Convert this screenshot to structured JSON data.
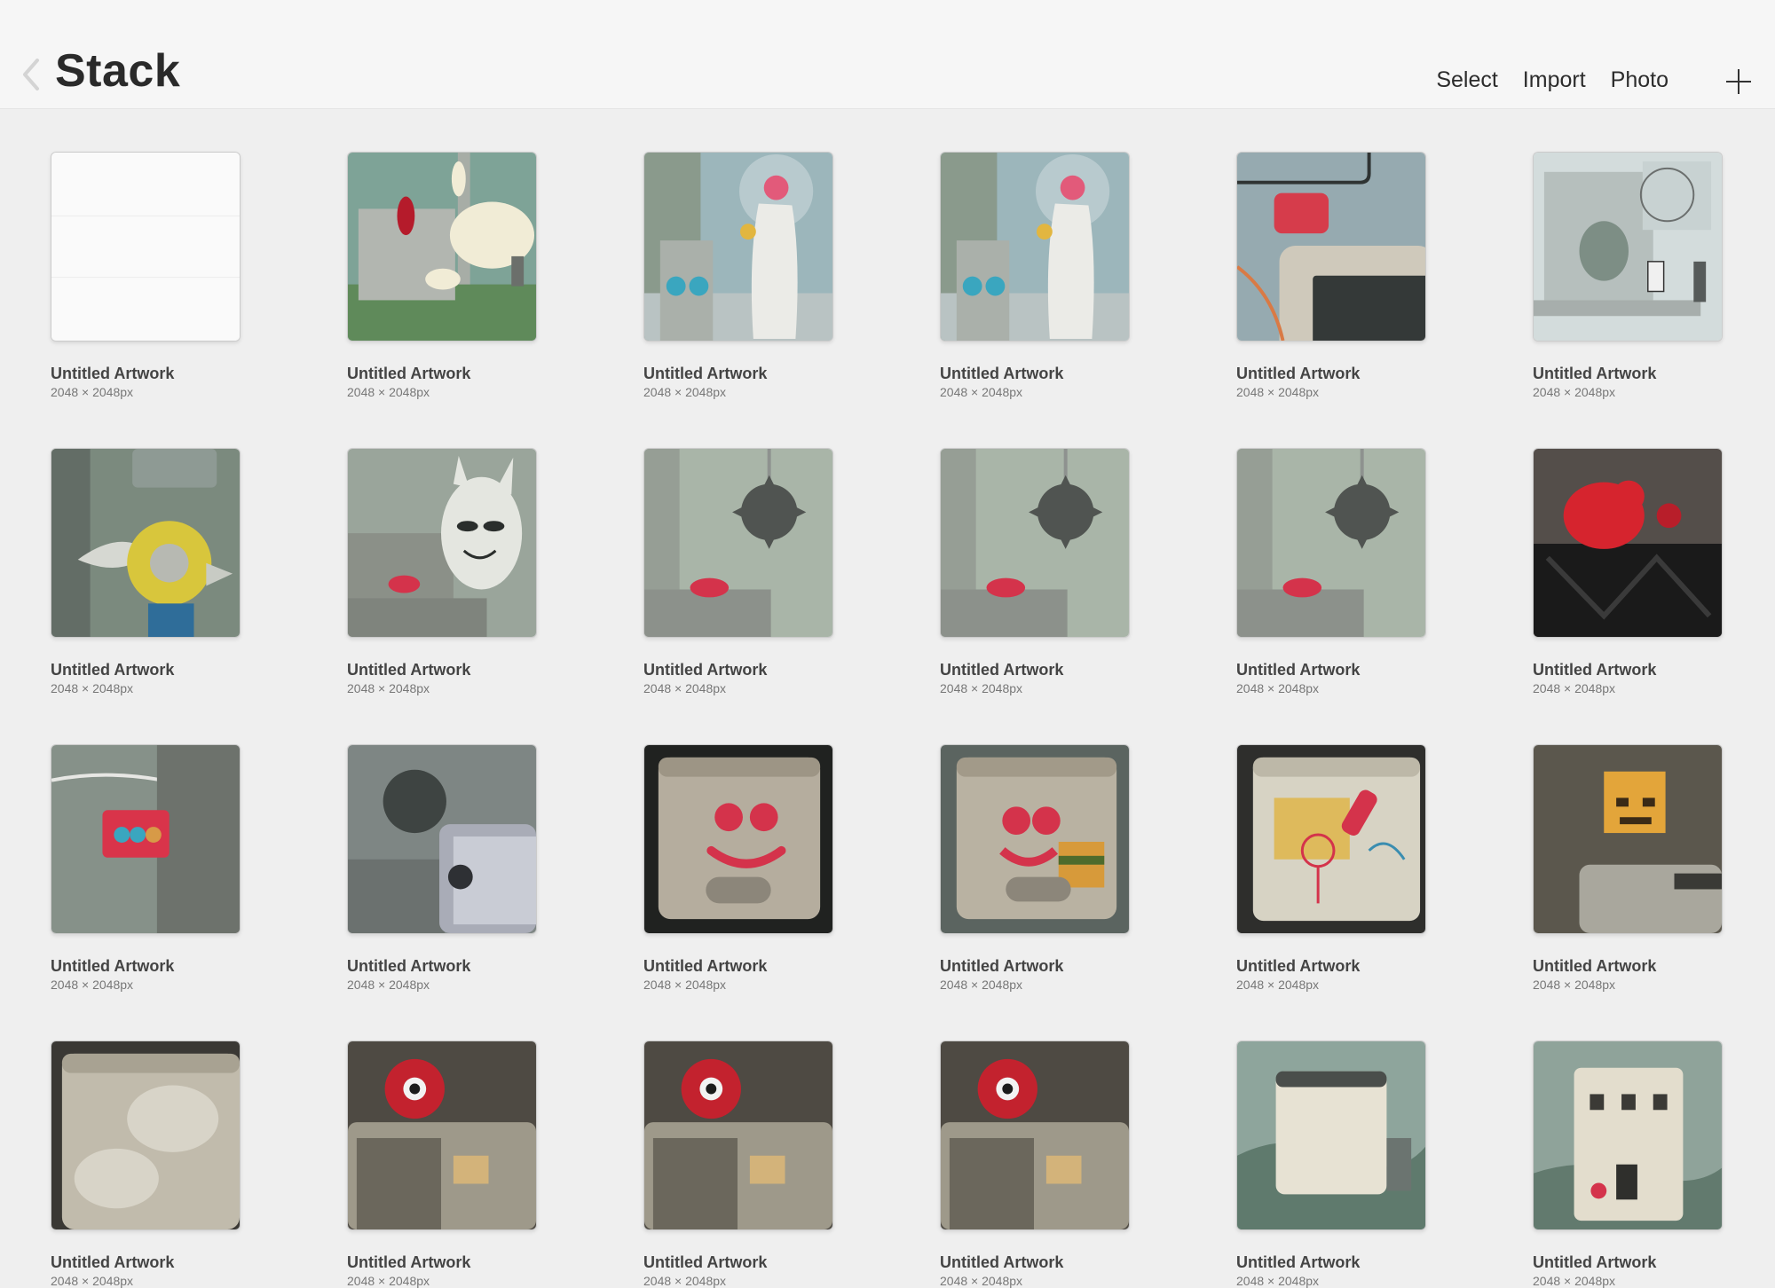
{
  "header": {
    "title": "Stack",
    "actions": [
      {
        "label": "Select"
      },
      {
        "label": "Import"
      },
      {
        "label": "Photo"
      }
    ],
    "back_icon": "chevron-left-icon",
    "add_icon": "plus-icon"
  },
  "artworks": [
    {
      "name": "Untitled Artwork",
      "size": "2048 × 2048px",
      "art": "blank"
    },
    {
      "name": "Untitled Artwork",
      "size": "2048 × 2048px",
      "art": "creature"
    },
    {
      "name": "Untitled Artwork",
      "size": "2048 × 2048px",
      "art": "astronaut"
    },
    {
      "name": "Untitled Artwork",
      "size": "2048 × 2048px",
      "art": "astronaut"
    },
    {
      "name": "Untitled Artwork",
      "size": "2048 × 2048px",
      "art": "cable"
    },
    {
      "name": "Untitled Artwork",
      "size": "2048 × 2048px",
      "art": "statue"
    },
    {
      "name": "Untitled Artwork",
      "size": "2048 × 2048px",
      "art": "fish"
    },
    {
      "name": "Untitled Artwork",
      "size": "2048 × 2048px",
      "art": "mask"
    },
    {
      "name": "Untitled Artwork",
      "size": "2048 × 2048px",
      "art": "mace"
    },
    {
      "name": "Untitled Artwork",
      "size": "2048 × 2048px",
      "art": "mace"
    },
    {
      "name": "Untitled Artwork",
      "size": "2048 × 2048px",
      "art": "mace"
    },
    {
      "name": "Untitled Artwork",
      "size": "2048 × 2048px",
      "art": "gorilla"
    },
    {
      "name": "Untitled Artwork",
      "size": "2048 × 2048px",
      "art": "gondola"
    },
    {
      "name": "Untitled Artwork",
      "size": "2048 × 2048px",
      "art": "cube"
    },
    {
      "name": "Untitled Artwork",
      "size": "2048 × 2048px",
      "art": "window-face"
    },
    {
      "name": "Untitled Artwork",
      "size": "2048 × 2048px",
      "art": "window-burger"
    },
    {
      "name": "Untitled Artwork",
      "size": "2048 × 2048px",
      "art": "window-drawing"
    },
    {
      "name": "Untitled Artwork",
      "size": "2048 × 2048px",
      "art": "pixel-sun"
    },
    {
      "name": "Untitled Artwork",
      "size": "2048 × 2048px",
      "art": "speech"
    },
    {
      "name": "Untitled Artwork",
      "size": "2048 × 2048px",
      "art": "eye-robot"
    },
    {
      "name": "Untitled Artwork",
      "size": "2048 × 2048px",
      "art": "eye-robot"
    },
    {
      "name": "Untitled Artwork",
      "size": "2048 × 2048px",
      "art": "eye-robot"
    },
    {
      "name": "Untitled Artwork",
      "size": "2048 × 2048px",
      "art": "landscape-window"
    },
    {
      "name": "Untitled Artwork",
      "size": "2048 × 2048px",
      "art": "castle"
    }
  ]
}
